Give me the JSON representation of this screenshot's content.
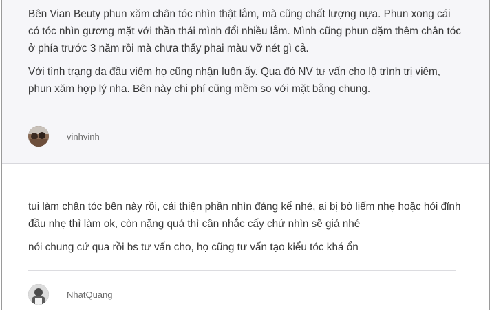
{
  "reviews": [
    {
      "paragraphs": [
        "Bên Vian Beuty phun xăm chân tóc nhìn thật lắm, mà cũng chất lượng nựa. Phun xong cái có tóc nhìn gương mặt với thần thái mình đổi nhiều lắm. Mình cũng phun dặm thêm chân tóc ở phía trước 3 năm rồi mà chưa thấy phai màu vỡ nét gì cả.",
        "Với tình trạng da đầu viêm họ cũng nhận luôn ấy. Qua đó NV tư vấn cho lộ trình trị viêm, phun xăm hợp lý nha. Bên này chi phí cũng mềm so với mặt bằng chung."
      ],
      "author": "vinhvinh"
    },
    {
      "paragraphs": [
        "tui làm chân tóc bên này rồi, cải thiện phần nhìn đáng kể nhé, ai bị bò liếm nhẹ hoặc hói đỉnh đầu nhẹ thì làm ok, còn nặng quá thì cân nhắc cấy chứ nhìn sẽ giả nhé",
        "nói chung cứ qua rồi bs tư vấn cho, họ cũng tư vấn tạo kiểu tóc khá ổn"
      ],
      "author": "NhatQuang"
    }
  ]
}
